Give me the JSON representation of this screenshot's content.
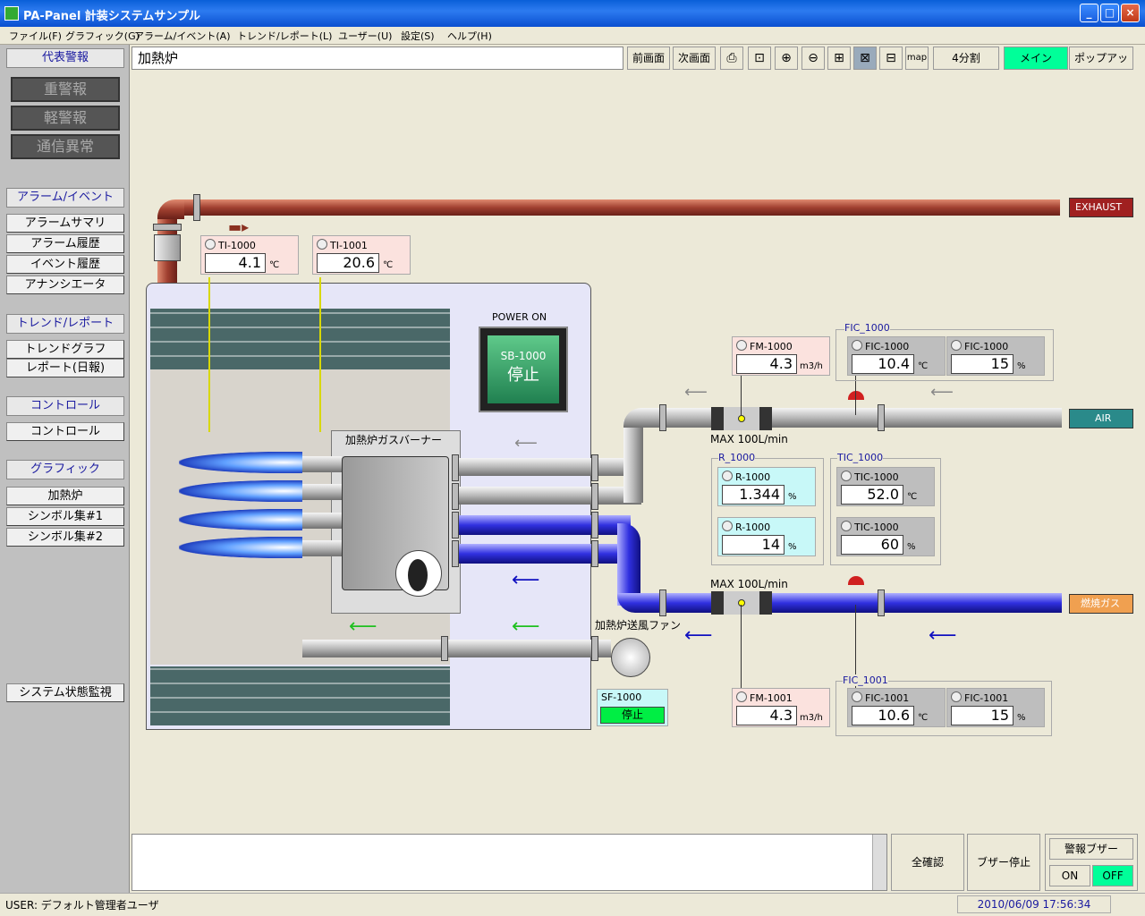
{
  "window": {
    "title": "PA-Panel 計装システムサンプル"
  },
  "menu": [
    "ファイル(F)",
    "グラフィック(G)",
    "アラーム/イベント(A)",
    "トレンド/レポート(L)",
    "ユーザー(U)",
    "設定(S)",
    "ヘルプ(H)"
  ],
  "sidebar": {
    "alarm_header": "代表警報",
    "alarms": [
      "重警報",
      "軽警報",
      "通信異常"
    ],
    "alarm_section": "アラーム/イベント",
    "alarm_items": [
      "アラームサマリ",
      "アラーム履歴",
      "イベント履歴",
      "アナンシエータ"
    ],
    "trend_section": "トレンド/レポート",
    "trend_items": [
      "トレンドグラフ",
      "レポート(日報)"
    ],
    "control_section": "コントロール",
    "control_items": [
      "コントロール"
    ],
    "graphic_section": "グラフィック",
    "graphic_items": [
      "加熱炉",
      "シンボル集#1",
      "シンボル集#2"
    ],
    "system_monitor": "システム状態監視"
  },
  "toolbar": {
    "page_title": "加熱炉",
    "prev": "前画面",
    "next": "次画面",
    "map": "map",
    "split": "4分割",
    "main": "メイン",
    "popup": "ポップアップ"
  },
  "process": {
    "exhaust": "EXHAUST",
    "air": "AIR",
    "fuel": "燃焼ガス",
    "power_label": "POWER ON",
    "sb_tag": "SB-1000",
    "sb_state": "停止",
    "burner_label": "加熱炉ガスバーナー",
    "fan_label": "加熱炉送風ファン",
    "sf_tag": "SF-1000",
    "sf_state": "停止",
    "max_air": "MAX 100L/min",
    "max_fuel": "MAX 100L/min",
    "ti1000": {
      "tag": "TI-1000",
      "value": "4.1",
      "unit": "℃"
    },
    "ti1001": {
      "tag": "TI-1001",
      "value": "20.6",
      "unit": "℃"
    },
    "fm1000": {
      "tag": "FM-1000",
      "value": "4.3",
      "unit": "m3/h"
    },
    "fic1000_group": "FIC_1000",
    "fic1000a": {
      "tag": "FIC-1000",
      "value": "10.4",
      "unit": "℃"
    },
    "fic1000b": {
      "tag": "FIC-1000",
      "value": "15",
      "unit": "%"
    },
    "r1000_group": "R_1000",
    "r1000a": {
      "tag": "R-1000",
      "value": "1.344",
      "unit": "%"
    },
    "r1000b": {
      "tag": "R-1000",
      "value": "14",
      "unit": "%"
    },
    "tic1000_group": "TIC_1000",
    "tic1000a": {
      "tag": "TIC-1000",
      "value": "52.0",
      "unit": "℃"
    },
    "tic1000b": {
      "tag": "TIC-1000",
      "value": "60",
      "unit": "%"
    },
    "fm1001": {
      "tag": "FM-1001",
      "value": "4.3",
      "unit": "m3/h"
    },
    "fic1001_group": "FIC_1001",
    "fic1001a": {
      "tag": "FIC-1001",
      "value": "10.6",
      "unit": "℃"
    },
    "fic1001b": {
      "tag": "FIC-1001",
      "value": "15",
      "unit": "%"
    }
  },
  "bottom": {
    "ack_all": "全確認",
    "buzzer_stop": "ブザー停止",
    "buzzer_label": "警報ブザー",
    "on": "ON",
    "off": "OFF"
  },
  "status": {
    "user": "USER: デフォルト管理者ユーザ",
    "datetime": "2010/06/09 17:56:34"
  },
  "colors": {
    "green_active": "#00ff66",
    "title_blue": "#0a5fd8"
  }
}
